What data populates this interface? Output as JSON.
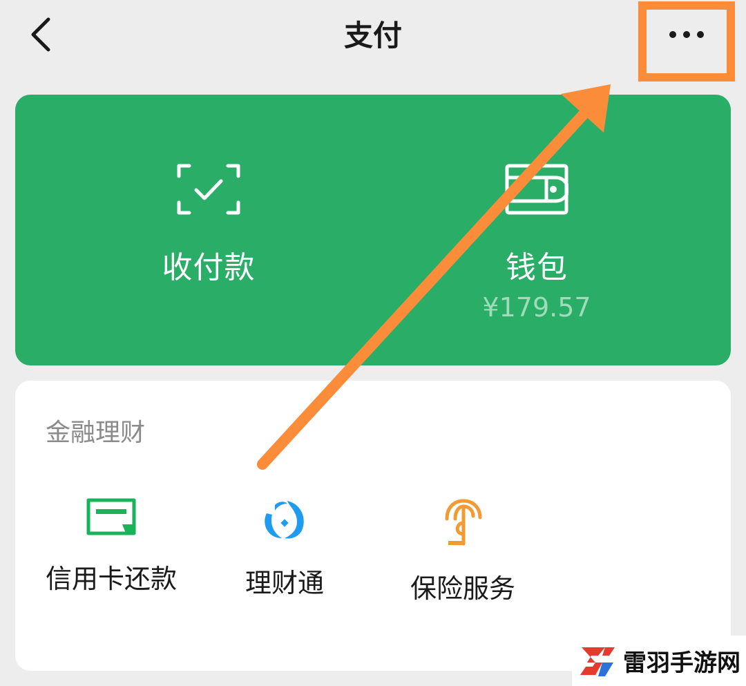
{
  "header": {
    "title": "支付"
  },
  "pay_card": {
    "receive_label": "收付款",
    "wallet_label": "钱包",
    "wallet_balance": "¥179.57",
    "color": "#2aae67"
  },
  "finance": {
    "section_title": "金融理财",
    "services": [
      {
        "label": "信用卡还款",
        "icon": "credit-card-icon",
        "color": "#18b35a"
      },
      {
        "label": "理财通",
        "icon": "licaitong-icon",
        "color": "#1f9bf0"
      },
      {
        "label": "保险服务",
        "icon": "insurance-icon",
        "color": "#f39a32"
      }
    ]
  },
  "annotation": {
    "highlight_color": "#fb8c3a"
  },
  "watermark": {
    "text": "雷羽手游网"
  }
}
